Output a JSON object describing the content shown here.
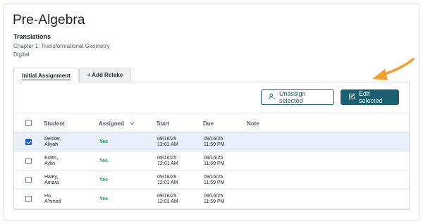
{
  "header": {
    "title": "Pre-Algebra",
    "assignment_title": "Translations",
    "chapter": "Chapter 1: Transformational Geometry",
    "mode": "Digital"
  },
  "tabs": [
    {
      "label": "Initial Assignment",
      "active": true
    },
    {
      "label": "+ Add Retake",
      "active": false
    }
  ],
  "toolbar": {
    "unassign_label": "Unassign selected",
    "unassign_icon": "user-minus-icon",
    "edit_label": "Edit selected",
    "edit_icon": "pencil-square-icon"
  },
  "table": {
    "columns": [
      "Student",
      "Assigned",
      "Start",
      "Due",
      "Note"
    ],
    "sort_icon": "chevron-down-icon",
    "rows": [
      {
        "checked": true,
        "last": "Decker,",
        "first": "Aliyah",
        "assigned": "Yes",
        "start_date": "09/16/25",
        "start_time": "12:01 AM",
        "due_date": "09/16/25",
        "due_time": "11:59 PM",
        "note": ""
      },
      {
        "checked": false,
        "last": "Estes,",
        "first": "Aylin",
        "assigned": "Yes",
        "start_date": "09/16/25",
        "start_time": "12:01 AM",
        "due_date": "09/16/25",
        "due_time": "11:59 PM",
        "note": ""
      },
      {
        "checked": false,
        "last": "Haley,",
        "first": "Amara",
        "assigned": "Yes",
        "start_date": "09/16/25",
        "start_time": "12:01 AM",
        "due_date": "09/16/25",
        "due_time": "11:59 PM",
        "note": ""
      },
      {
        "checked": false,
        "last": "Ho,",
        "first": "A'hmed",
        "assigned": "Yes",
        "start_date": "09/16/25",
        "start_time": "12:01 AM",
        "due_date": "09/16/25",
        "due_time": "11:59 PM",
        "note": ""
      }
    ]
  },
  "colors": {
    "primary": "#1c5f70",
    "assigned_yes": "#1a9a5a",
    "selected_row": "#e9f0fb",
    "checkbox_checked": "#1f5fbf",
    "annotation_arrow": "#f0a030"
  },
  "annotation": {
    "type": "arrow",
    "icon": "arrow-annotation-icon",
    "points_to": "edit-selected-button"
  }
}
